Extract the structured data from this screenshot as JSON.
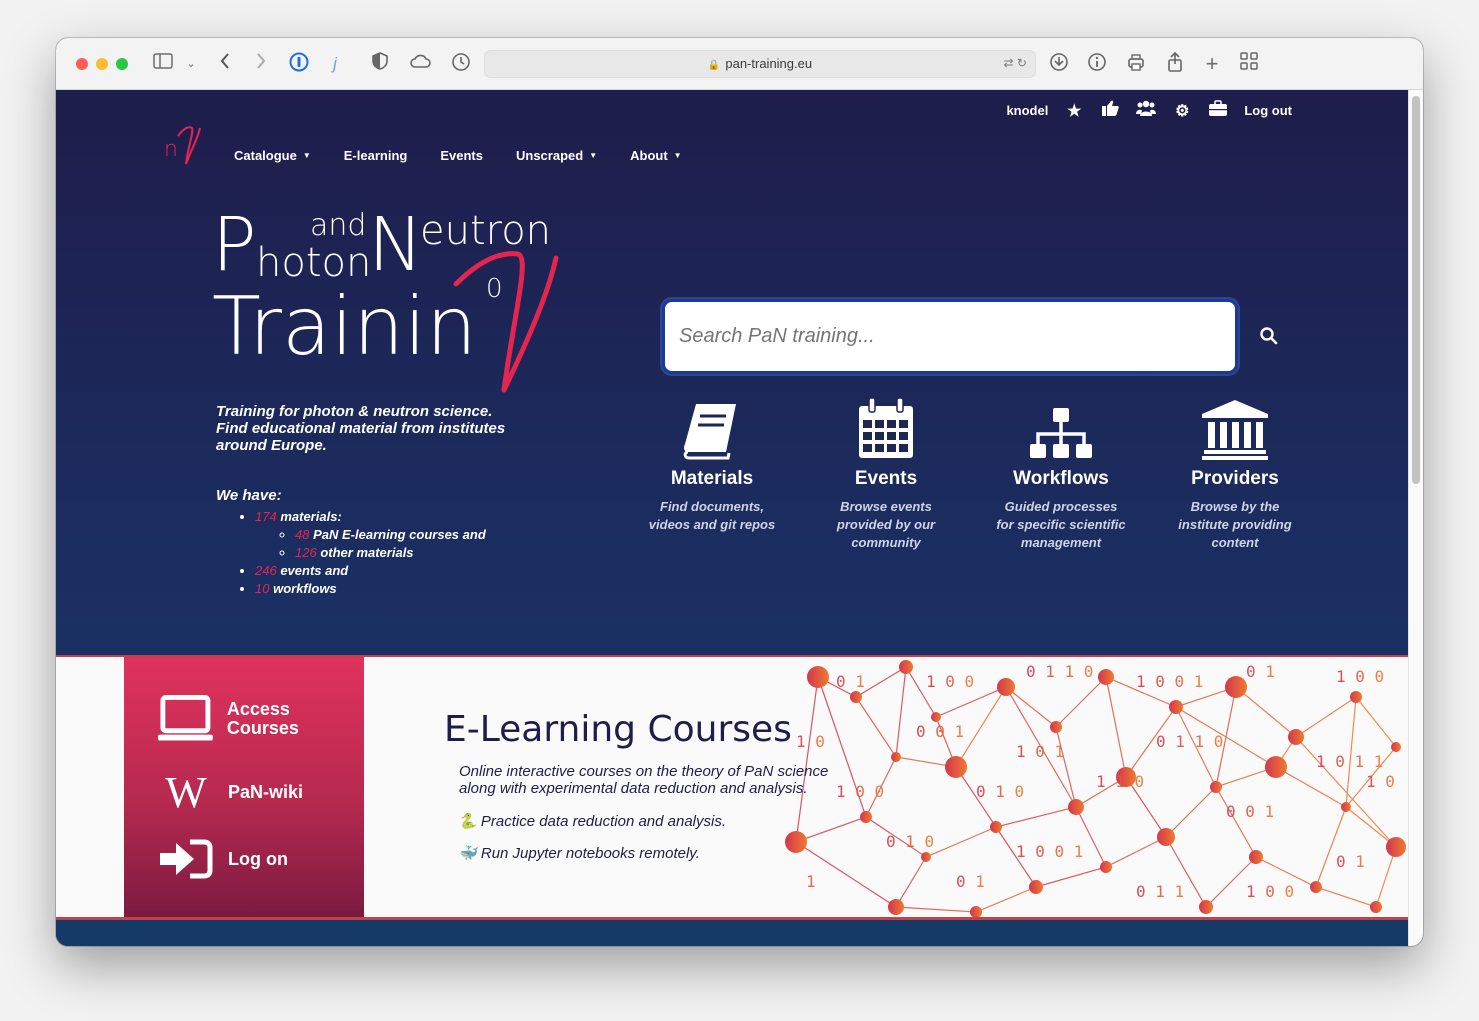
{
  "browser": {
    "url": "pan-training.eu"
  },
  "userbar": {
    "username": "knodel",
    "logout": "Log out"
  },
  "nav": {
    "catalogue": "Catalogue",
    "elearning": "E-learning",
    "events": "Events",
    "unscraped": "Unscraped",
    "about": "About"
  },
  "brand": {
    "line_and": "and",
    "line_photon": "Photon",
    "line_neutron": "Neutron",
    "line_training": "Trainin",
    "superscript": "0"
  },
  "tagline": {
    "line1": "Training for photon & neutron science.",
    "line2": "Find educational material from institutes",
    "line3": "around Europe."
  },
  "stats": {
    "heading": "We have:",
    "materials_count": "174",
    "materials_label": "materials:",
    "elearning_count": "48",
    "elearning_label": "PaN E-learning courses and",
    "other_count": "126",
    "other_label": "other materials",
    "events_count": "246",
    "events_label": "events and",
    "workflows_count": "10",
    "workflows_label": "workflows"
  },
  "search": {
    "placeholder": "Search PaN training..."
  },
  "categories": [
    {
      "label": "Materials",
      "description": "Find documents, videos and git repos",
      "icon": "book-icon"
    },
    {
      "label": "Events",
      "description": "Browse events provided by our community",
      "icon": "calendar-icon"
    },
    {
      "label": "Workflows",
      "description": "Guided processes for specific scientific management",
      "icon": "sitemap-icon"
    },
    {
      "label": "Providers",
      "description": "Browse by the institute providing content",
      "icon": "institution-icon"
    }
  ],
  "elearning": {
    "access_courses": "Access Courses",
    "panwiki": "PaN-wiki",
    "logon": "Log on",
    "title": "E-Learning Courses",
    "text_line1": "Online interactive courses on the theory of PaN science",
    "text_line2": "along with experimental data reduction and analysis.",
    "point1": "Practice data reduction and analysis.",
    "point2": "Run Jupyter notebooks remotely."
  },
  "colors": {
    "accent": "#e2264f",
    "navy": "#1e1d4b"
  }
}
